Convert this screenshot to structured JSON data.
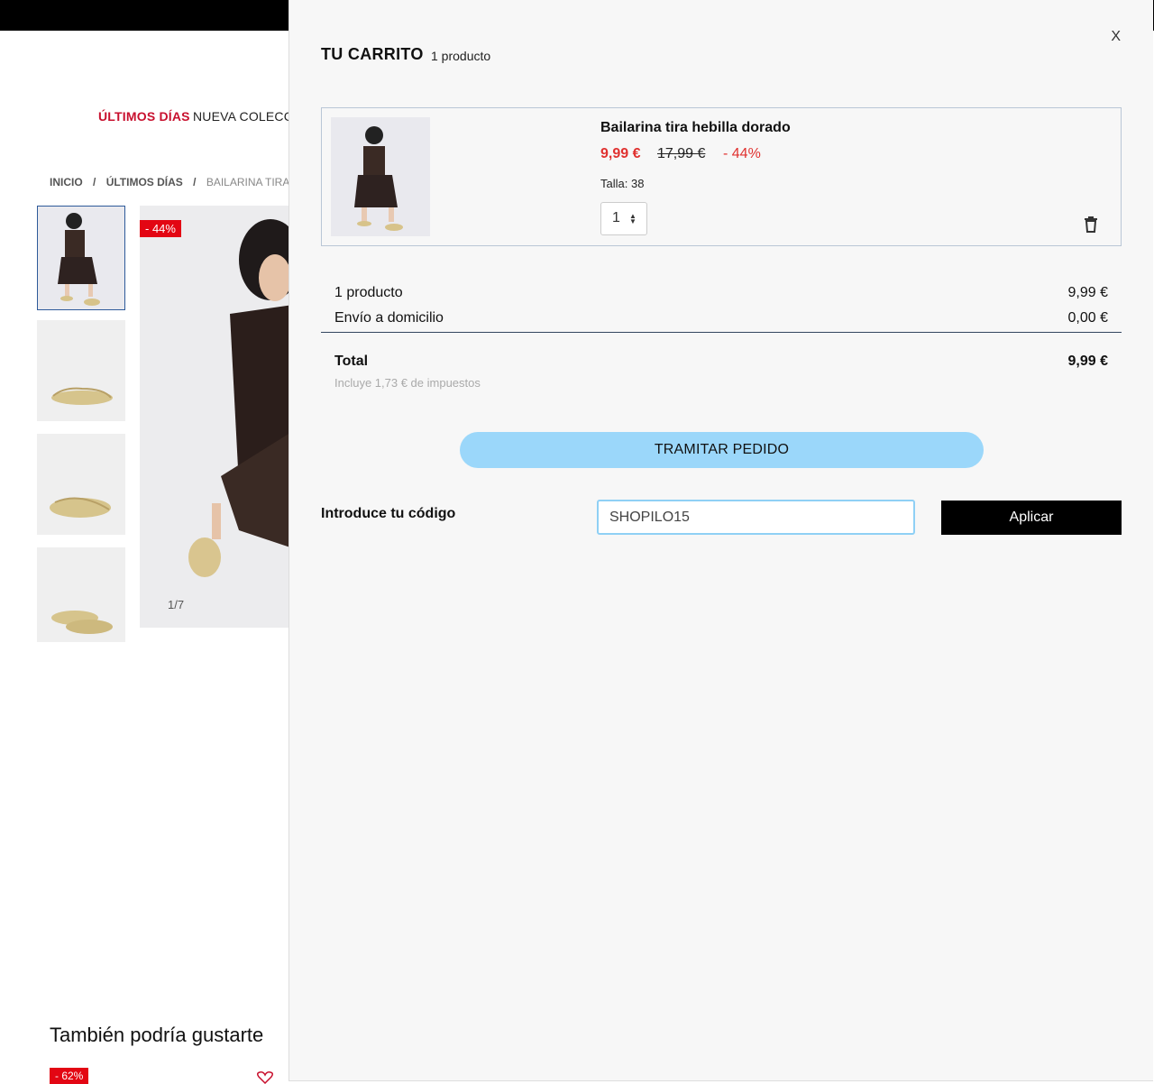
{
  "page": {
    "nav": {
      "last_days": "ÚLTIMOS DÍAS",
      "new_collection": "NUEVA COLECC"
    },
    "breadcrumb": {
      "home": "INICIO",
      "sep1": "/",
      "category": "ÚLTIMOS DÍAS",
      "sep2": "/",
      "current": "BAILARINA TIRA H"
    },
    "gallery": {
      "discount_badge": "- 44%",
      "counter": "1/7"
    },
    "recommendations": {
      "title": "También podría gustarte",
      "badge": "- 62%"
    }
  },
  "cart": {
    "title": "TU CARRITO",
    "count": "1 producto",
    "close": "X",
    "item": {
      "name": "Bailarina tira hebilla dorado",
      "price": "9,99 €",
      "old_price": "17,99 €",
      "discount": "- 44%",
      "size": "Talla: 38",
      "quantity": "1"
    },
    "summary": {
      "products_label": "1 producto",
      "products_value": "9,99 €",
      "shipping_label": "Envío a domicilio",
      "shipping_value": "0,00 €",
      "total_label": "Total",
      "total_value": "9,99 €",
      "tax_note": "Incluye 1,73 € de impuestos"
    },
    "checkout_label": "TRAMITAR PEDIDO",
    "promo": {
      "label": "Introduce tu código",
      "value": "SHOPILO15",
      "apply_label": "Aplicar"
    }
  },
  "colors": {
    "accent_red": "#e0312f",
    "checkout_blue": "#9bd7fa",
    "badge_red": "#e30613"
  }
}
